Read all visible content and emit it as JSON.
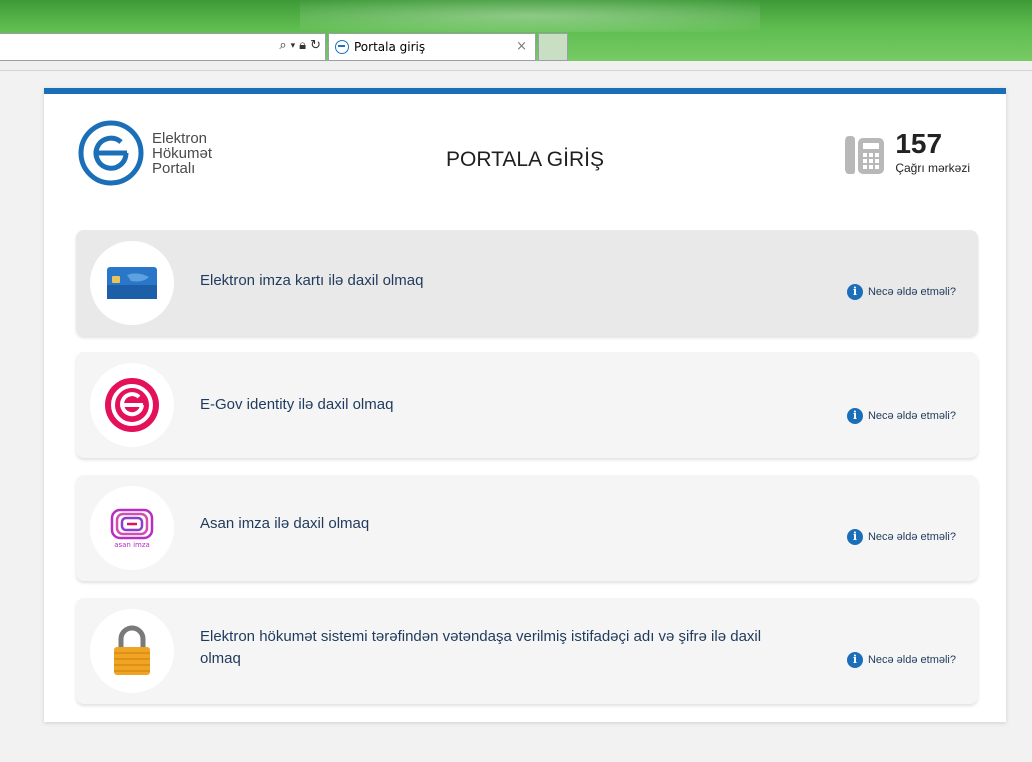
{
  "browser": {
    "tab_title": "Portala giriş",
    "tab_close": "×",
    "addr_icons": [
      "search-icon",
      "dropdown-icon",
      "lock-icon",
      "refresh-icon"
    ]
  },
  "header": {
    "logo_lines": [
      "Elektron",
      "Hökumət",
      "Portalı"
    ],
    "title": "PORTALA GİRİŞ",
    "call_number": "157",
    "call_label": "Çağrı mərkəzi"
  },
  "options": [
    {
      "label": "Elektron imza kartı ilə daxil olmaq",
      "help": "Necə əldə etməli?",
      "icon": "smart-card-icon"
    },
    {
      "label": "E-Gov identity ilə daxil olmaq",
      "help": "Necə əldə etməli?",
      "icon": "egov-logo-icon"
    },
    {
      "label": "Asan imza ilə daxil olmaq",
      "help": "Necə əldə etməli?",
      "icon": "asan-imza-icon",
      "icon_text": "asan imza"
    },
    {
      "label": "Elektron hökumət sistemi tərəfindən vətəndaşa verilmiş istifadəçi adı və şifrə ilə daxil olmaq",
      "help": "Necə əldə etməli?",
      "icon": "padlock-icon"
    }
  ],
  "colors": {
    "accent": "#1b6fb8",
    "egov_pink": "#e4105a",
    "asan_purple": "#b52fc4",
    "lock_orange": "#f0a423"
  }
}
